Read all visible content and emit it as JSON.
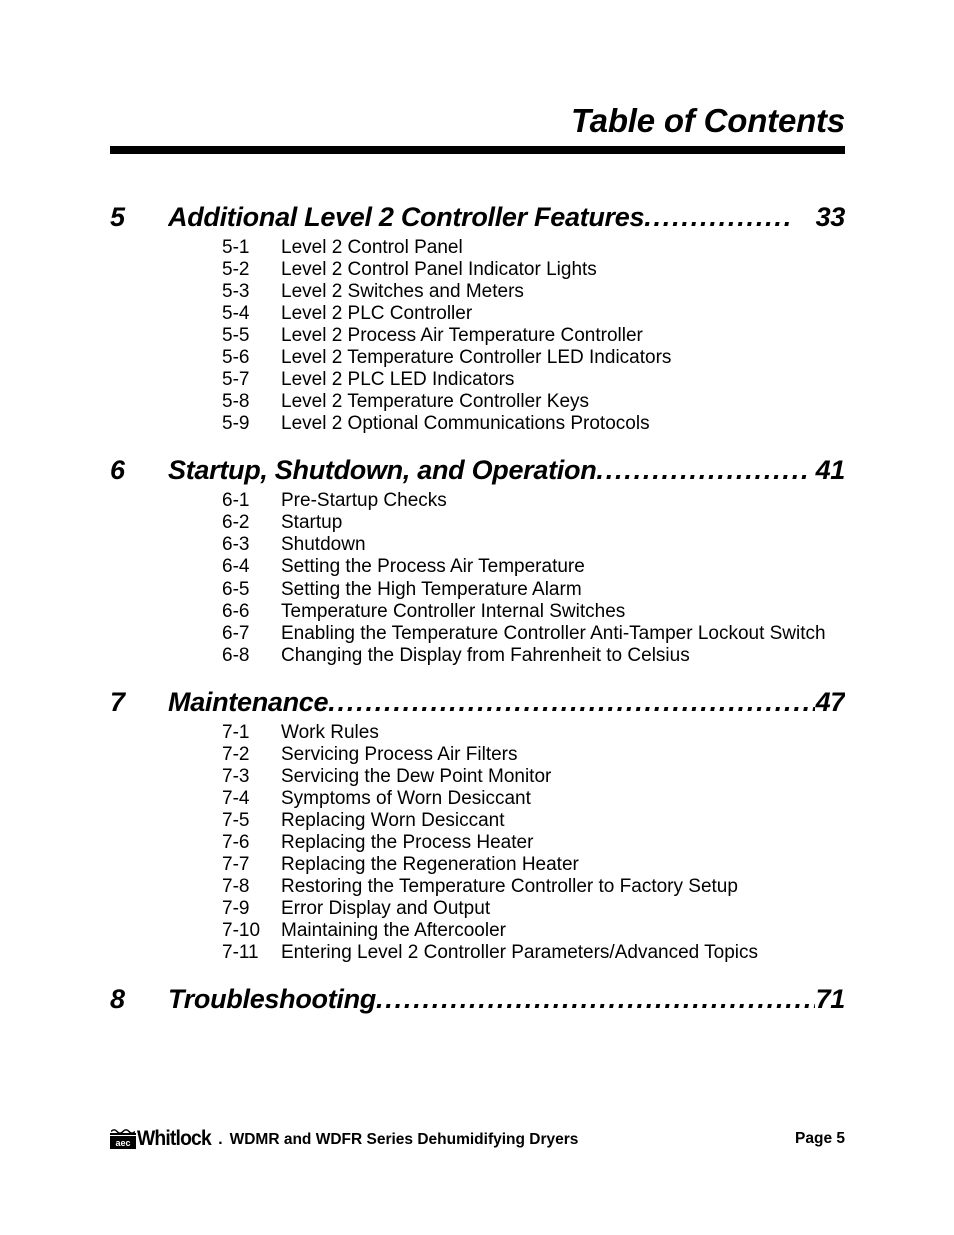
{
  "header": {
    "title": "Table of Contents"
  },
  "toc": {
    "chapters": [
      {
        "number": "5",
        "title": "Additional Level 2 Controller Features",
        "leader": "................",
        "page": "33",
        "subitems": [
          {
            "number": "5-1",
            "label": "Level 2 Control Panel"
          },
          {
            "number": "5-2",
            "label": "Level 2 Control Panel Indicator Lights"
          },
          {
            "number": "5-3",
            "label": "Level 2 Switches and Meters"
          },
          {
            "number": "5-4",
            "label": "Level 2 PLC Controller"
          },
          {
            "number": "5-5",
            "label": "Level 2 Process Air Temperature Controller"
          },
          {
            "number": "5-6",
            "label": "Level 2 Temperature Controller LED Indicators"
          },
          {
            "number": "5-7",
            "label": "Level 2 PLC LED Indicators"
          },
          {
            "number": "5-8",
            "label": "Level 2 Temperature Controller Keys"
          },
          {
            "number": "5-9",
            "label": "Level 2 Optional Communications Protocols"
          }
        ]
      },
      {
        "number": "6",
        "title": "Startup, Shutdown, and Operation",
        "leader": ".......................",
        "page": "41",
        "subitems": [
          {
            "number": "6-1",
            "label": "Pre-Startup Checks"
          },
          {
            "number": "6-2",
            "label": "Startup"
          },
          {
            "number": "6-3",
            "label": "Shutdown"
          },
          {
            "number": "6-4",
            "label": "Setting the Process Air Temperature"
          },
          {
            "number": "6-5",
            "label": "Setting the High Temperature Alarm"
          },
          {
            "number": "6-6",
            "label": "Temperature Controller Internal Switches"
          },
          {
            "number": "6-7",
            "label": "Enabling the Temperature Controller Anti-Tamper Lockout Switch"
          },
          {
            "number": "6-8",
            "label": "Changing the Display from Fahrenheit to Celsius"
          }
        ]
      },
      {
        "number": "7",
        "title": "Maintenance",
        "leader": "...........................................................",
        "page": "47",
        "subitems": [
          {
            "number": "7-1",
            "label": "Work Rules"
          },
          {
            "number": "7-2",
            "label": "Servicing Process Air Filters"
          },
          {
            "number": "7-3",
            "label": "Servicing the Dew Point Monitor"
          },
          {
            "number": "7-4",
            "label": "Symptoms of Worn Desiccant"
          },
          {
            "number": "7-5",
            "label": "Replacing Worn Desiccant"
          },
          {
            "number": "7-6",
            "label": "Replacing the Process Heater"
          },
          {
            "number": "7-7",
            "label": "Replacing the Regeneration Heater"
          },
          {
            "number": "7-8",
            "label": "Restoring the Temperature Controller to Factory Setup"
          },
          {
            "number": "7-9",
            "label": "Error Display and Output"
          },
          {
            "number": "7-10",
            "label": "Maintaining the Aftercooler"
          },
          {
            "number": "7-11",
            "label": "Entering Level 2 Controller Parameters/Advanced Topics"
          }
        ]
      },
      {
        "number": "8",
        "title": "Troubleshooting",
        "leader": ".....................................................",
        "page": "71",
        "subitems": []
      }
    ]
  },
  "footer": {
    "logo_mark_text": "aec",
    "logo_word": "Whitlock",
    "logo_trademark": ".",
    "subtitle": "WDMR and WDFR Series Dehumidifying Dryers",
    "page_label": "Page 5"
  }
}
